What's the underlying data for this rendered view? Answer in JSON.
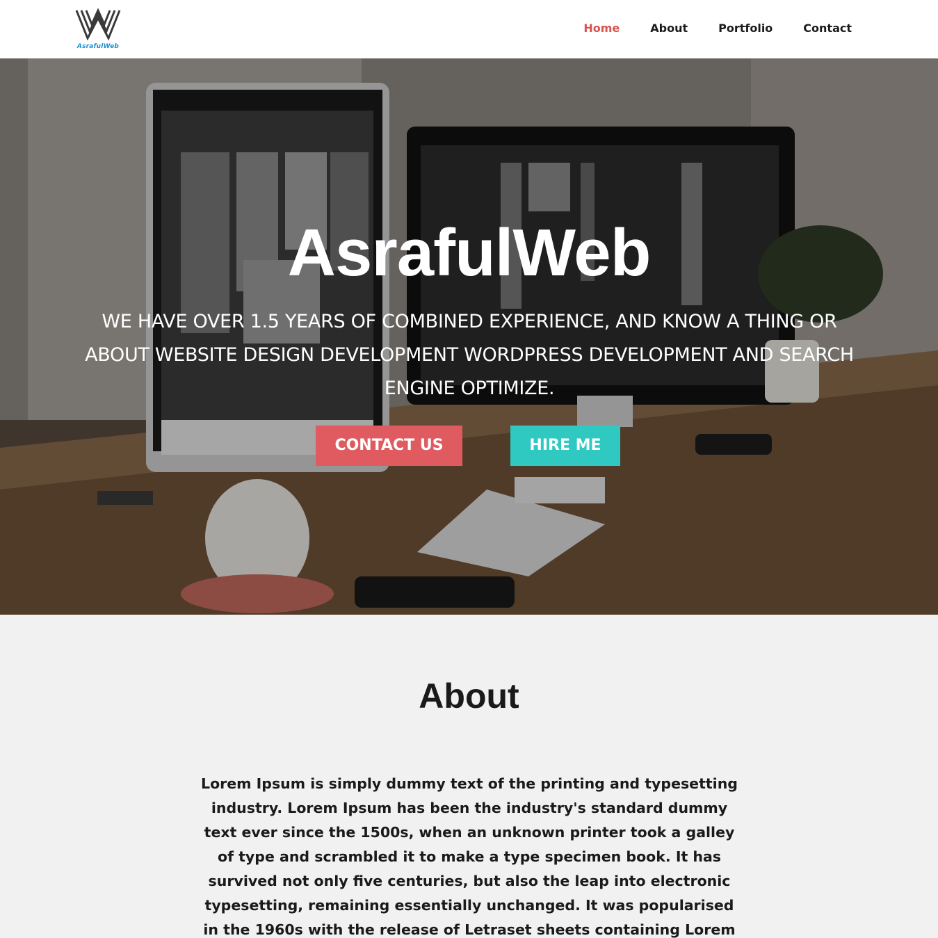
{
  "brand": {
    "logo_text": "AsrafulWeb"
  },
  "nav": {
    "items": [
      {
        "label": "Home",
        "active": true
      },
      {
        "label": "About",
        "active": false
      },
      {
        "label": "Portfolio",
        "active": false
      },
      {
        "label": "Contact",
        "active": false
      }
    ]
  },
  "hero": {
    "title": "AsrafulWeb",
    "subtitle": "WE HAVE OVER 1.5 YEARS OF COMBINED EXPERIENCE, AND KNOW A THING OR ABOUT WEBSITE DESIGN DEVELOPMENT WORDPRESS DEVELOPMENT AND SEARCH ENGINE OPTIMIZE.",
    "contact_button": "CONTACT US",
    "hire_button": "HIRE ME"
  },
  "about": {
    "title": "About",
    "body": "Lorem Ipsum is simply dummy text of the printing and typesetting industry. Lorem Ipsum has been the industry's standard dummy text ever since the 1500s, when an unknown printer took a galley of type and scrambled it to make a type specimen book. It has survived not only five centuries, but also the leap into electronic typesetting, remaining essentially unchanged. It was popularised in the 1960s with the release of Letraset sheets containing Lorem Ipsum passages, and"
  },
  "colors": {
    "accent_red": "#e05b5f",
    "accent_teal": "#2fc9c1",
    "nav_active": "#d9534f",
    "logo_blue": "#1b8fd6"
  }
}
